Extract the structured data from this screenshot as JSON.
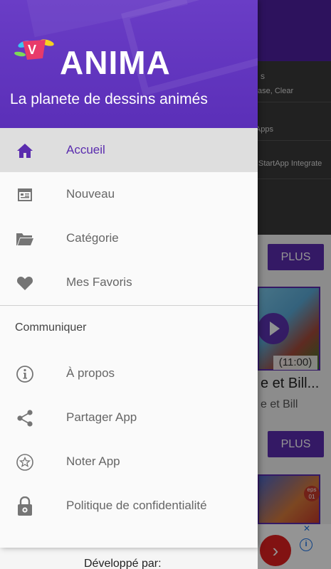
{
  "background": {
    "banner_rows": [
      {
        "head": "s",
        "sub": "ase, Clear"
      },
      {
        "head": "",
        "sub": "l Apps"
      },
      {
        "head": "",
        "sub": "StartApp Integrate"
      }
    ],
    "plus_label_1": "PLUS",
    "plus_label_2": "PLUS",
    "video_duration": "(11:00)",
    "video_title": "e et Bill...",
    "video_subtitle": "e et Bill",
    "thumb2_badge": "eps 01",
    "ad_close": "✕",
    "ad_info": "i",
    "ad_cta": "›"
  },
  "drawer": {
    "brand_letter": "V",
    "brand": "ANIMA",
    "tagline": "La planete de dessins animés",
    "menu_items": [
      {
        "label": "Accueil",
        "icon": "home-icon",
        "active": true
      },
      {
        "label": "Nouveau",
        "icon": "calendar-icon",
        "active": false
      },
      {
        "label": "Catégorie",
        "icon": "folder-icon",
        "active": false
      },
      {
        "label": "Mes Favoris",
        "icon": "heart-icon",
        "active": false
      }
    ],
    "section_title": "Communiquer",
    "communicate_items": [
      {
        "label": "À propos",
        "icon": "info-icon"
      },
      {
        "label": "Partager App",
        "icon": "share-icon"
      },
      {
        "label": "Noter App",
        "icon": "star-icon"
      },
      {
        "label": "Politique de confidentialité",
        "icon": "lock-gear-icon"
      }
    ]
  },
  "footer": {
    "developed_by": "Développé par:"
  },
  "colors": {
    "accent": "#5a2cae",
    "header": "#6a3dc6",
    "active_bg": "#dedede"
  }
}
